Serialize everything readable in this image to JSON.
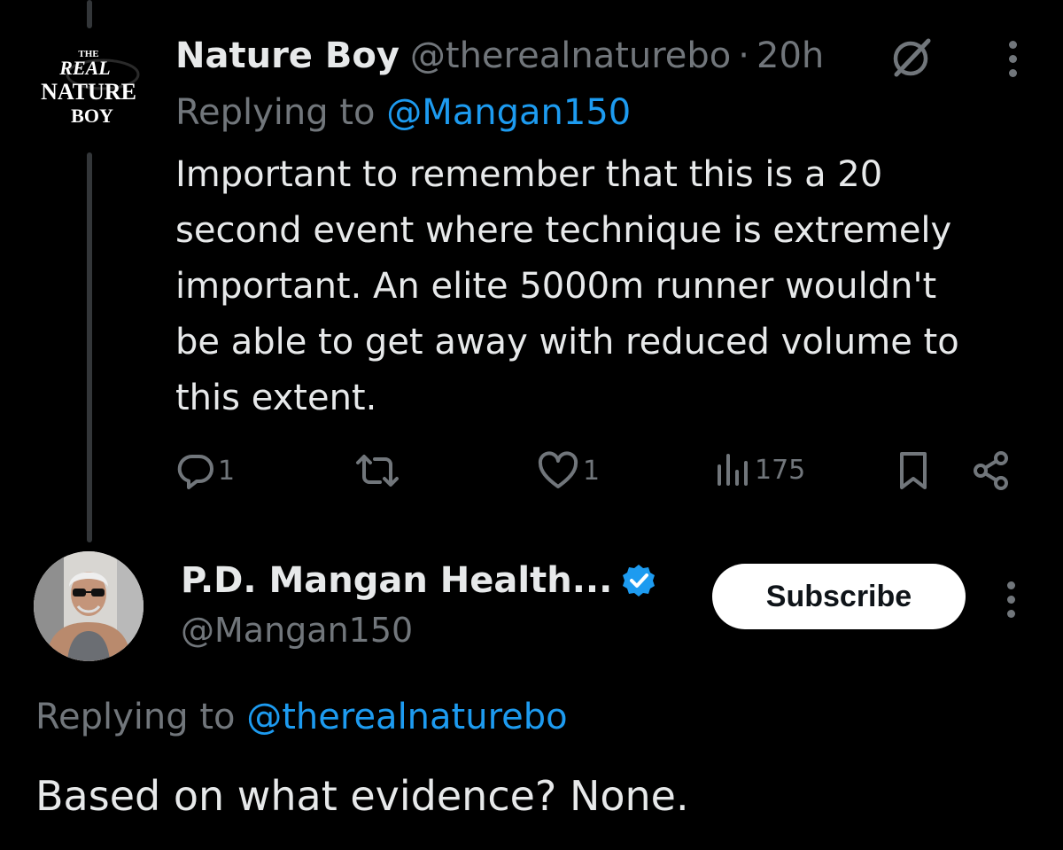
{
  "colors": {
    "background": "#000000",
    "text": "#e7e9ea",
    "secondary": "#71767b",
    "link": "#1d9bf0",
    "verified": "#1d9bf0",
    "subscribe_bg": "#ffffff",
    "subscribe_text": "#0f1419"
  },
  "tweet1": {
    "display_name": "Nature Boy",
    "handle": "@therealnaturebo",
    "separator": "·",
    "time": "20h",
    "replying_prefix": "Replying to",
    "replying_to": "@Mangan150",
    "body_lines": [
      "Important to remember that this is a 20",
      "second event where technique is extremely",
      "important.  An elite 5000m runner wouldn't",
      "be able to get away with reduced volume to",
      "this extent."
    ],
    "avatar_logo": {
      "line1": "THE",
      "line2": "REAL",
      "line3": "NATURE",
      "line4": "BOY"
    },
    "actions": {
      "reply_count": "1",
      "retweet_count": "",
      "like_count": "1",
      "views_count": "175"
    },
    "icons": {
      "grok": "grok-icon",
      "more": "more-options-icon",
      "reply": "reply-icon",
      "retweet": "retweet-icon",
      "like": "heart-icon",
      "views": "views-icon",
      "bookmark": "bookmark-icon",
      "share": "share-icon"
    }
  },
  "tweet2": {
    "display_name": "P.D. Mangan Health...",
    "handle": "@Mangan150",
    "subscribe_label": "Subscribe",
    "replying_prefix": "Replying to",
    "replying_to": "@therealnaturebo",
    "body": "Based on what evidence? None.",
    "icons": {
      "verified": "verified-badge-icon",
      "more": "more-options-icon"
    }
  }
}
